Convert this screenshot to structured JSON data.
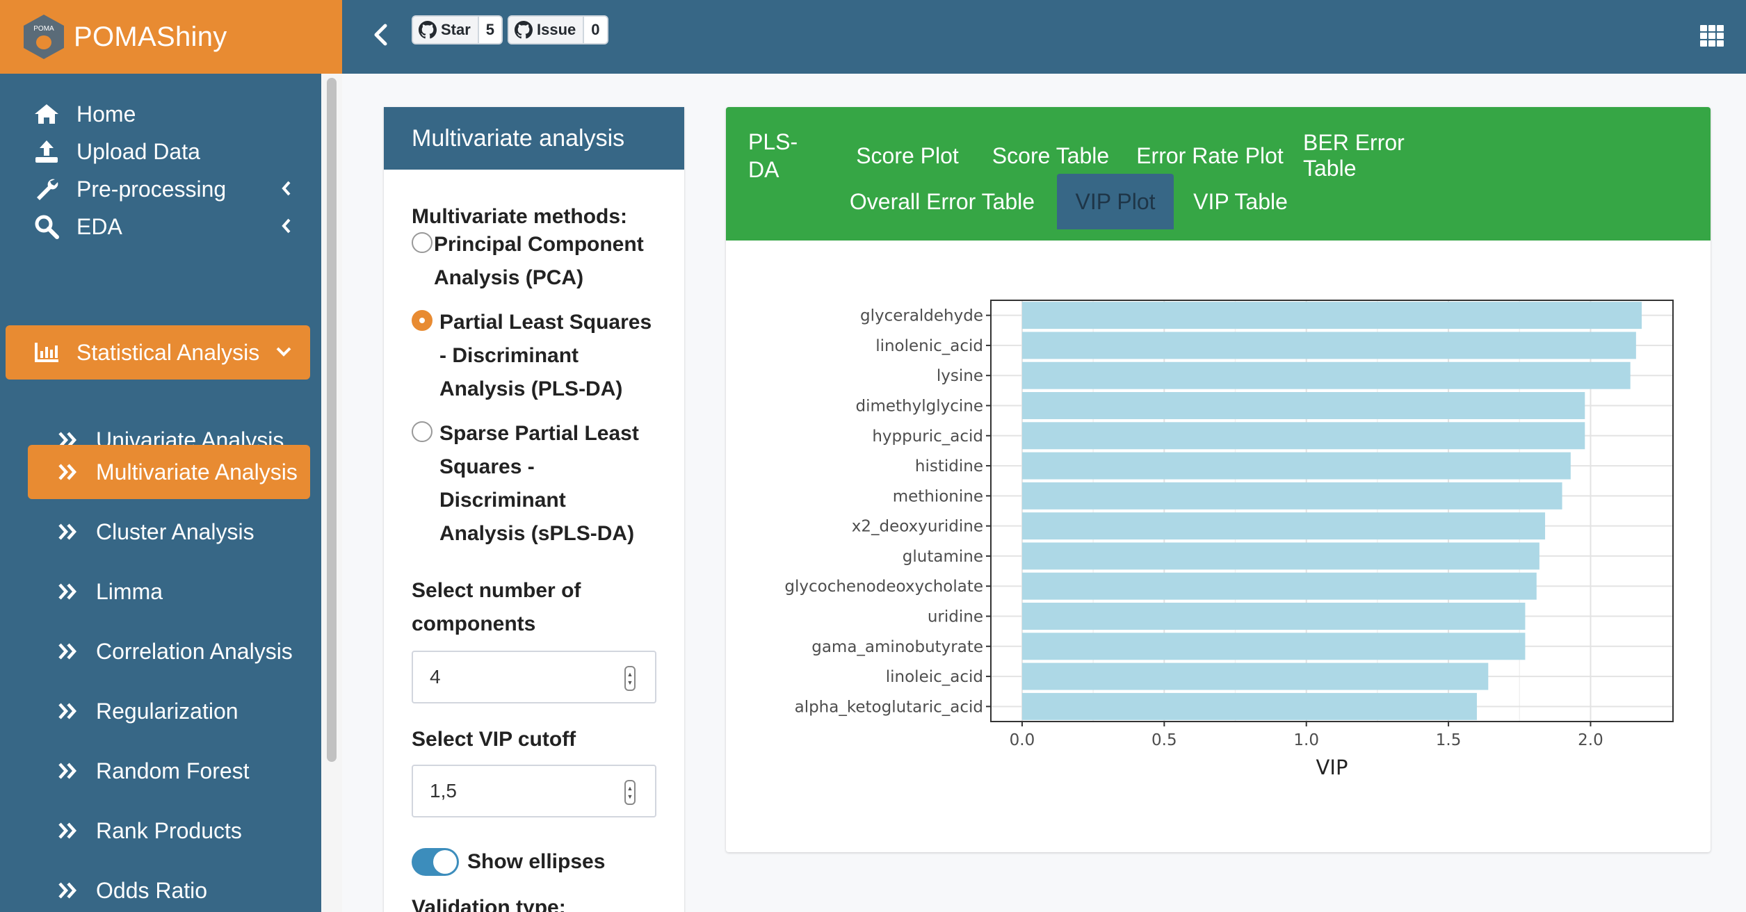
{
  "app": {
    "title": "POMAShiny",
    "logo_text": "POMA",
    "accent": "#e88b32",
    "header_blue": "#376786"
  },
  "github": {
    "star_label": "Star",
    "star_count": "5",
    "issue_label": "Issue",
    "issue_count": "0"
  },
  "sidebar": {
    "items": [
      {
        "label": "Home",
        "icon": "home-icon"
      },
      {
        "label": "Upload Data",
        "icon": "upload-icon"
      },
      {
        "label": "Pre-processing",
        "icon": "wrench-icon"
      },
      {
        "label": "EDA",
        "icon": "search-icon"
      },
      {
        "label": "Statistical Analysis",
        "icon": "bar-chart-icon",
        "active": true
      }
    ],
    "subitems": [
      {
        "label": "Univariate Analysis"
      },
      {
        "label": "Multivariate Analysis",
        "active": true
      },
      {
        "label": "Cluster Analysis"
      },
      {
        "label": "Limma"
      },
      {
        "label": "Correlation Analysis"
      },
      {
        "label": "Regularization"
      },
      {
        "label": "Random Forest"
      },
      {
        "label": "Rank Products"
      },
      {
        "label": "Odds Ratio"
      }
    ]
  },
  "panel": {
    "title": "Multivariate analysis",
    "methods_label": "Multivariate methods:",
    "methods": [
      {
        "label": "Principal Component Analysis (PCA)",
        "checked": false
      },
      {
        "label": "Partial Least Squares - Discriminant Analysis (PLS-DA)",
        "checked": true
      },
      {
        "label": "Sparse Partial Least Squares - Discriminant Analysis (sPLS-DA)",
        "checked": false
      }
    ],
    "components_label": "Select number of components",
    "components_value": "4",
    "vip_label": "Select VIP cutoff",
    "vip_value": "1,5",
    "ellipses_label": "Show ellipses",
    "ellipses_on": true,
    "validation_label": "Validation type:"
  },
  "tabs": {
    "title": "PLS-DA",
    "items": [
      {
        "label": "Score Plot"
      },
      {
        "label": "Score Table"
      },
      {
        "label": "Error Rate Plot"
      },
      {
        "label": "BER Error Table"
      },
      {
        "label": "Overall Error Table"
      },
      {
        "label": "VIP Plot",
        "active": true
      },
      {
        "label": "VIP Table"
      }
    ]
  },
  "chart_data": {
    "type": "bar",
    "orientation": "horizontal",
    "categories": [
      "glyceraldehyde",
      "linolenic_acid",
      "lysine",
      "dimethylglycine",
      "hyppuric_acid",
      "histidine",
      "methionine",
      "x2_deoxyuridine",
      "glutamine",
      "glycochenodeoxycholate",
      "uridine",
      "gama_aminobutyrate",
      "linoleic_acid",
      "alpha_ketoglutaric_acid"
    ],
    "values": [
      2.18,
      2.16,
      2.14,
      1.98,
      1.98,
      1.93,
      1.9,
      1.84,
      1.82,
      1.81,
      1.77,
      1.77,
      1.64,
      1.6
    ],
    "xlabel": "VIP",
    "ylabel": "",
    "xlim": [
      -0.11,
      2.29
    ],
    "xticks": [
      "0.0",
      "0.5",
      "1.0",
      "1.5",
      "2.0"
    ],
    "bar_color": "#add8e6",
    "grid": true
  }
}
